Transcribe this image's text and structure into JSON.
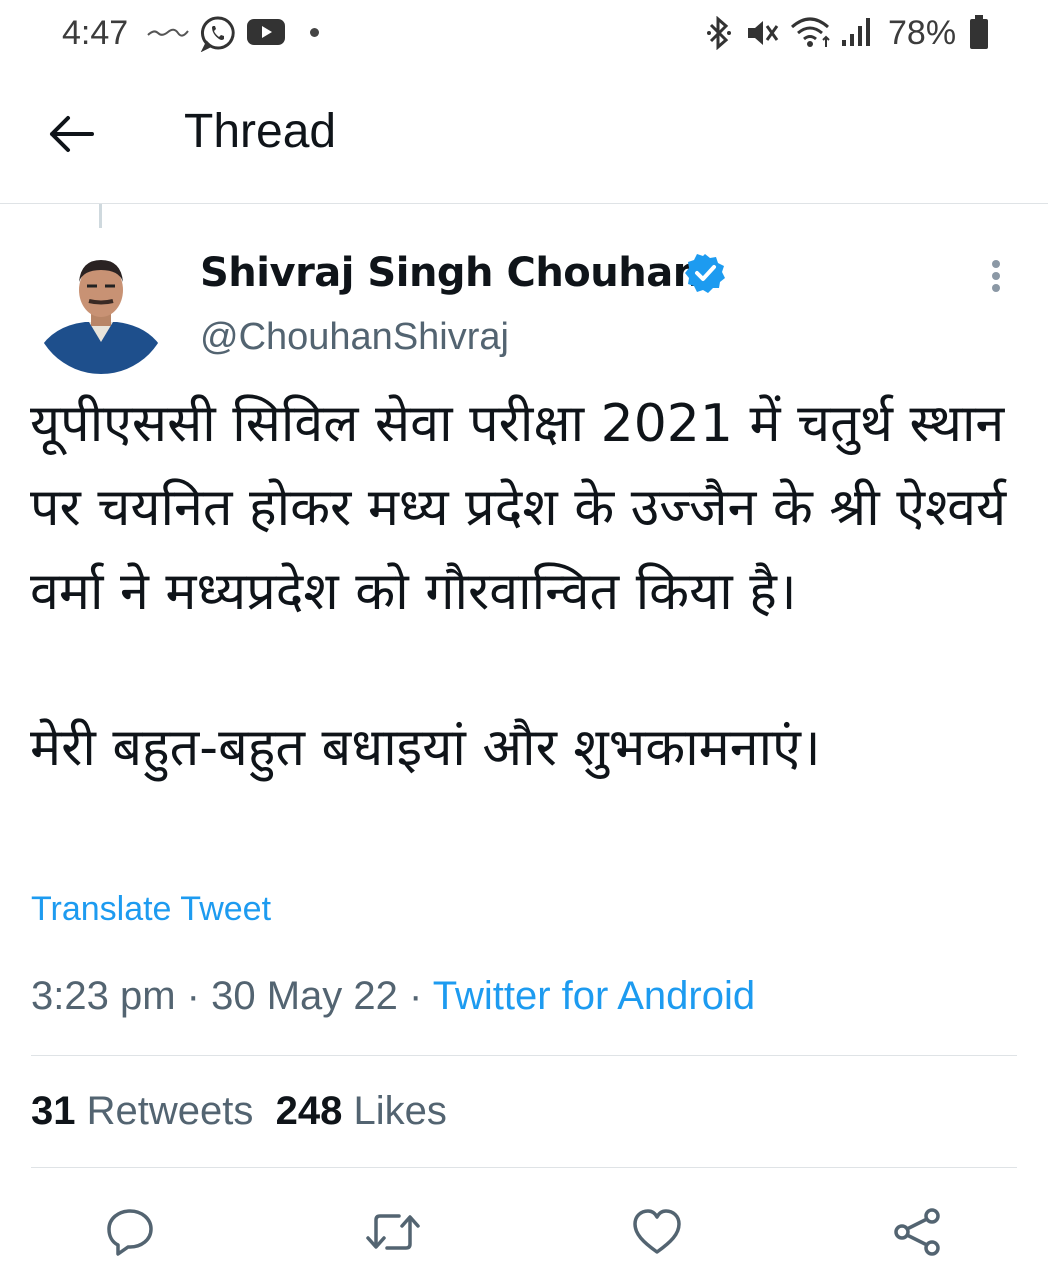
{
  "status_bar": {
    "time": "4:47",
    "battery_percent": "78%",
    "icons": [
      "news-icon",
      "whatsapp-icon",
      "youtube-icon",
      "notification-dot",
      "bluetooth-icon",
      "mute-icon",
      "wifi-icon",
      "signal-icon",
      "battery-icon"
    ]
  },
  "header": {
    "title": "Thread",
    "back_icon": "arrow-left-icon"
  },
  "tweet": {
    "author_name": "Shivraj Singh Chouhan",
    "author_handle": "@ChouhanShivraj",
    "verified": true,
    "paragraphs": [
      "यूपीएससी सिविल सेवा परीक्षा 2021 में चतुर्थ स्थान पर चयनित होकर मध्य प्रदेश के उज्जैन के श्री ऐश्वर्य वर्मा ने मध्यप्रदेश को गौरवान्वित किया है।",
      "मेरी बहुत-बहुत बधाइयां और शुभकामनाएं।"
    ],
    "translate_label": "Translate Tweet",
    "time": "3:23 pm",
    "date": "30 May 22",
    "separator": "·",
    "source": "Twitter for Android",
    "retweets_count": "31",
    "retweets_label": "Retweets",
    "likes_count": "248",
    "likes_label": "Likes"
  },
  "actions": [
    "reply-icon",
    "retweet-icon",
    "like-icon",
    "share-icon"
  ],
  "colors": {
    "link": "#1d9bf0",
    "secondary_text": "#536471",
    "primary_text": "#0f1419",
    "divider": "#dfe3e6"
  }
}
